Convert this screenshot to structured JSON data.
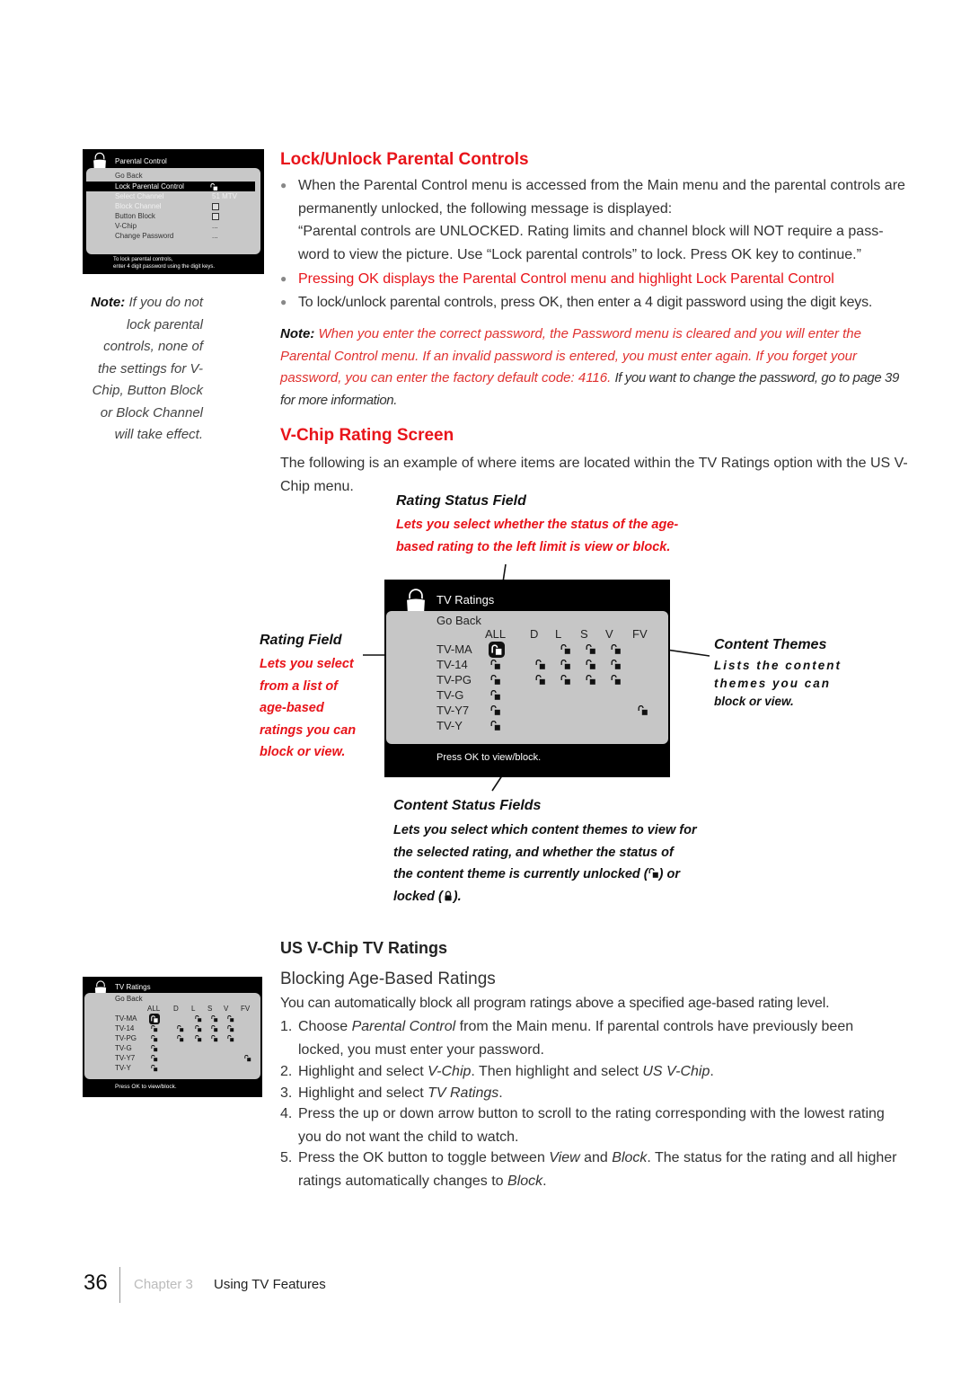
{
  "parental_osd": {
    "title": "Parental Control",
    "items": [
      {
        "label": "Go Back",
        "value": ""
      },
      {
        "label": "Lock Parental Control",
        "value": "unlocked-icon"
      },
      {
        "label": "Select Channel",
        "value": "51 MTV"
      },
      {
        "label": "Block Channel",
        "value": "checkbox"
      },
      {
        "label": "Button Block",
        "value": "checkbox"
      },
      {
        "label": "V-Chip",
        "value": "..."
      },
      {
        "label": "Change Password",
        "value": "..."
      }
    ],
    "highlighted": "Lock Parental Control",
    "footer_line1": "To lock parental controls,",
    "footer_line2": "enter 4 digit password using the digit keys."
  },
  "side_note": {
    "label": "Note:",
    "text": "If you do not lock parental controls, none of the settings for V-Chip, Button Block or Block Channel will take effect."
  },
  "section1": {
    "heading": "Lock/Unlock Parental Controls",
    "bullet1": "When the Parental Control menu is accessed from the Main menu and the parental controls are permanently unlocked, the following message is displayed:",
    "quote": "“Parental controls are UNLOCKED. Rating limits and channel block will NOT require a pass-word to view the picture. Use “Lock parental controls” to lock. Press OK key to continue.”",
    "bullet2": "Pressing OK displays the Parental Control menu and highlight Lock Parental Control",
    "bullet3": "To lock/unlock parental controls, press OK, then enter a 4 digit password using the digit keys.",
    "note_label": "Note:",
    "note_red": "When you enter the correct password, the Password menu is cleared and you will enter the Parental Control menu. If an invalid password is entered, you must enter again. If you forget your password, you can enter the factory default code: 4116.",
    "note_gray": "If you want to change the password, go to page 39 for more information."
  },
  "section2": {
    "heading": "V-Chip  Rating Screen",
    "intro": "The following is an example of where items are located within the TV Ratings option with the US V-Chip menu."
  },
  "callouts": {
    "rating_status": {
      "title": "Rating Status Field",
      "desc_line1": "Lets you select whether the status of the age-",
      "desc_line2": "based rating to the left limit is view or block."
    },
    "rating_field": {
      "title": "Rating Field",
      "lines": [
        "Lets you select",
        "from a list of",
        "age-based",
        "ratings you can",
        "block or view."
      ]
    },
    "content_themes": {
      "title": "Content Themes",
      "lines": [
        "Lists the content",
        "themes you can",
        "block or view."
      ]
    },
    "content_status": {
      "title": "Content Status Fields",
      "lines": [
        "Lets you select which content themes to view for",
        "the selected rating, and whether the status of",
        "the content theme is currently unlocked (",
        ") or",
        "locked (",
        ")."
      ]
    }
  },
  "tv_ratings_osd": {
    "title": "TV Ratings",
    "go_back": "Go Back",
    "columns": [
      "ALL",
      "D",
      "L",
      "S",
      "V",
      "FV"
    ],
    "rows": [
      {
        "rating": "TV-MA",
        "cells": [
          "selected-unlocked",
          "",
          "unlocked",
          "unlocked",
          "unlocked",
          ""
        ]
      },
      {
        "rating": "TV-14",
        "cells": [
          "unlocked",
          "unlocked",
          "unlocked",
          "unlocked",
          "unlocked",
          ""
        ]
      },
      {
        "rating": "TV-PG",
        "cells": [
          "unlocked",
          "unlocked",
          "unlocked",
          "unlocked",
          "unlocked",
          ""
        ]
      },
      {
        "rating": "TV-G",
        "cells": [
          "unlocked",
          "",
          "",
          "",
          "",
          ""
        ]
      },
      {
        "rating": "TV-Y7",
        "cells": [
          "unlocked",
          "",
          "",
          "",
          "",
          "unlocked"
        ]
      },
      {
        "rating": "TV-Y",
        "cells": [
          "unlocked",
          "",
          "",
          "",
          "",
          ""
        ]
      }
    ],
    "footer": "Press OK to view/block."
  },
  "section3": {
    "heading": "US V-Chip TV Ratings",
    "subheading": "Blocking  Age-Based Ratings",
    "intro": "You can automatically block all program ratings above a specified age-based rating level.",
    "steps": [
      {
        "n": "1.",
        "pre": "Choose ",
        "em": "Parental Control",
        "post": " from the Main menu. If parental controls have previously been locked, you must enter your password."
      },
      {
        "n": "2.",
        "pre": "Highlight and select ",
        "em": "V-Chip",
        "mid": ". Then highlight and select ",
        "em2": "US V-Chip",
        "post": "."
      },
      {
        "n": "3.",
        "pre": "Highlight and select ",
        "em": "TV Ratings",
        "post": "."
      },
      {
        "n": "4.",
        "pre": "Press the up or down arrow button to scroll to the rating corresponding with the lowest rating you do not want the child to watch.",
        "em": "",
        "post": ""
      },
      {
        "n": "5.",
        "pre": "Press the OK button to toggle between ",
        "em": "View",
        "mid": " and ",
        "em2": "Block",
        "post2": ". The status for the rating and all higher ratings automatically changes to ",
        "em3": "Block",
        "post": "."
      }
    ]
  },
  "footer": {
    "page_number": "36",
    "chapter": "Chapter 3",
    "title": "Using TV Features"
  },
  "colors": {
    "accent_red": "#e8141a",
    "osd_black": "#000000",
    "osd_panel": "#c6c6c6"
  }
}
